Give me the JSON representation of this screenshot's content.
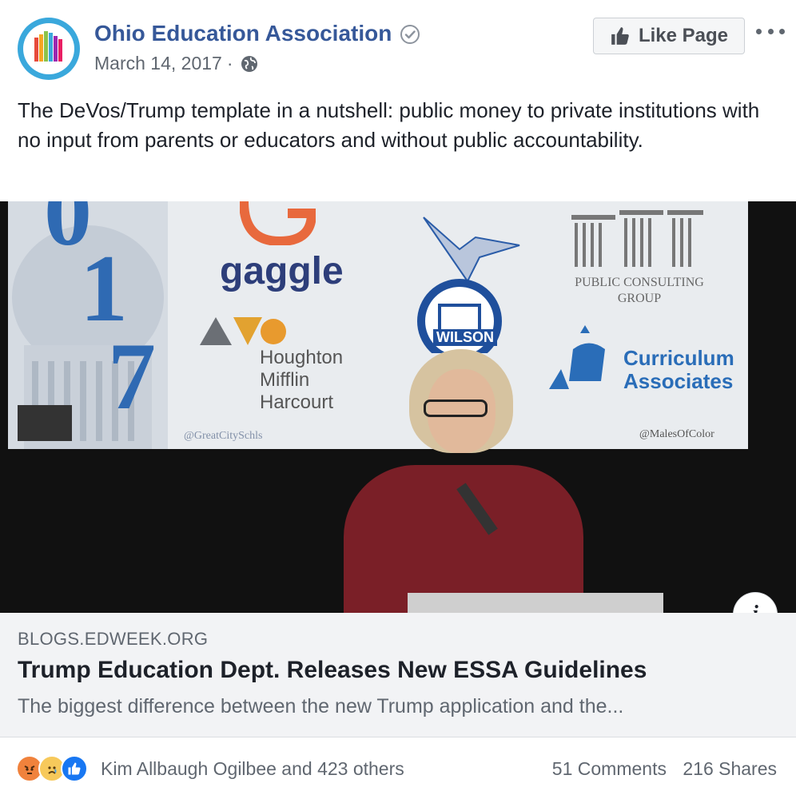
{
  "post": {
    "page_name": "Ohio Education Association",
    "date": "March 14, 2017",
    "separator": "·",
    "text": "The DeVos/Trump template in a nutshell: public money to private institutions with no input from parents or educators and without public accountability.",
    "like_label": "Like Page"
  },
  "image": {
    "banner_texts": {
      "gaggle": "gaggle",
      "hmh": "Houghton Mifflin Harcourt",
      "wilson": "WILSON",
      "pcg": "PUBLIC CONSULTING GROUP",
      "ca": "Curriculum Associates",
      "handle_left": "@GreatCitySchls",
      "handle_right": "@MalesOfColor"
    }
  },
  "link": {
    "domain": "BLOGS.EDWEEK.ORG",
    "title": "Trump Education Dept. Releases New ESSA Guidelines",
    "description": "The biggest difference between the new Trump application and the..."
  },
  "stats": {
    "reactors": "Kim Allbaugh Ogilbee and 423 others",
    "comments": "51 Comments",
    "shares": "216 Shares"
  },
  "colors": {
    "link_blue": "#365899",
    "angry": "#f0823c",
    "sad": "#f7c95b",
    "like": "#1877f2"
  }
}
